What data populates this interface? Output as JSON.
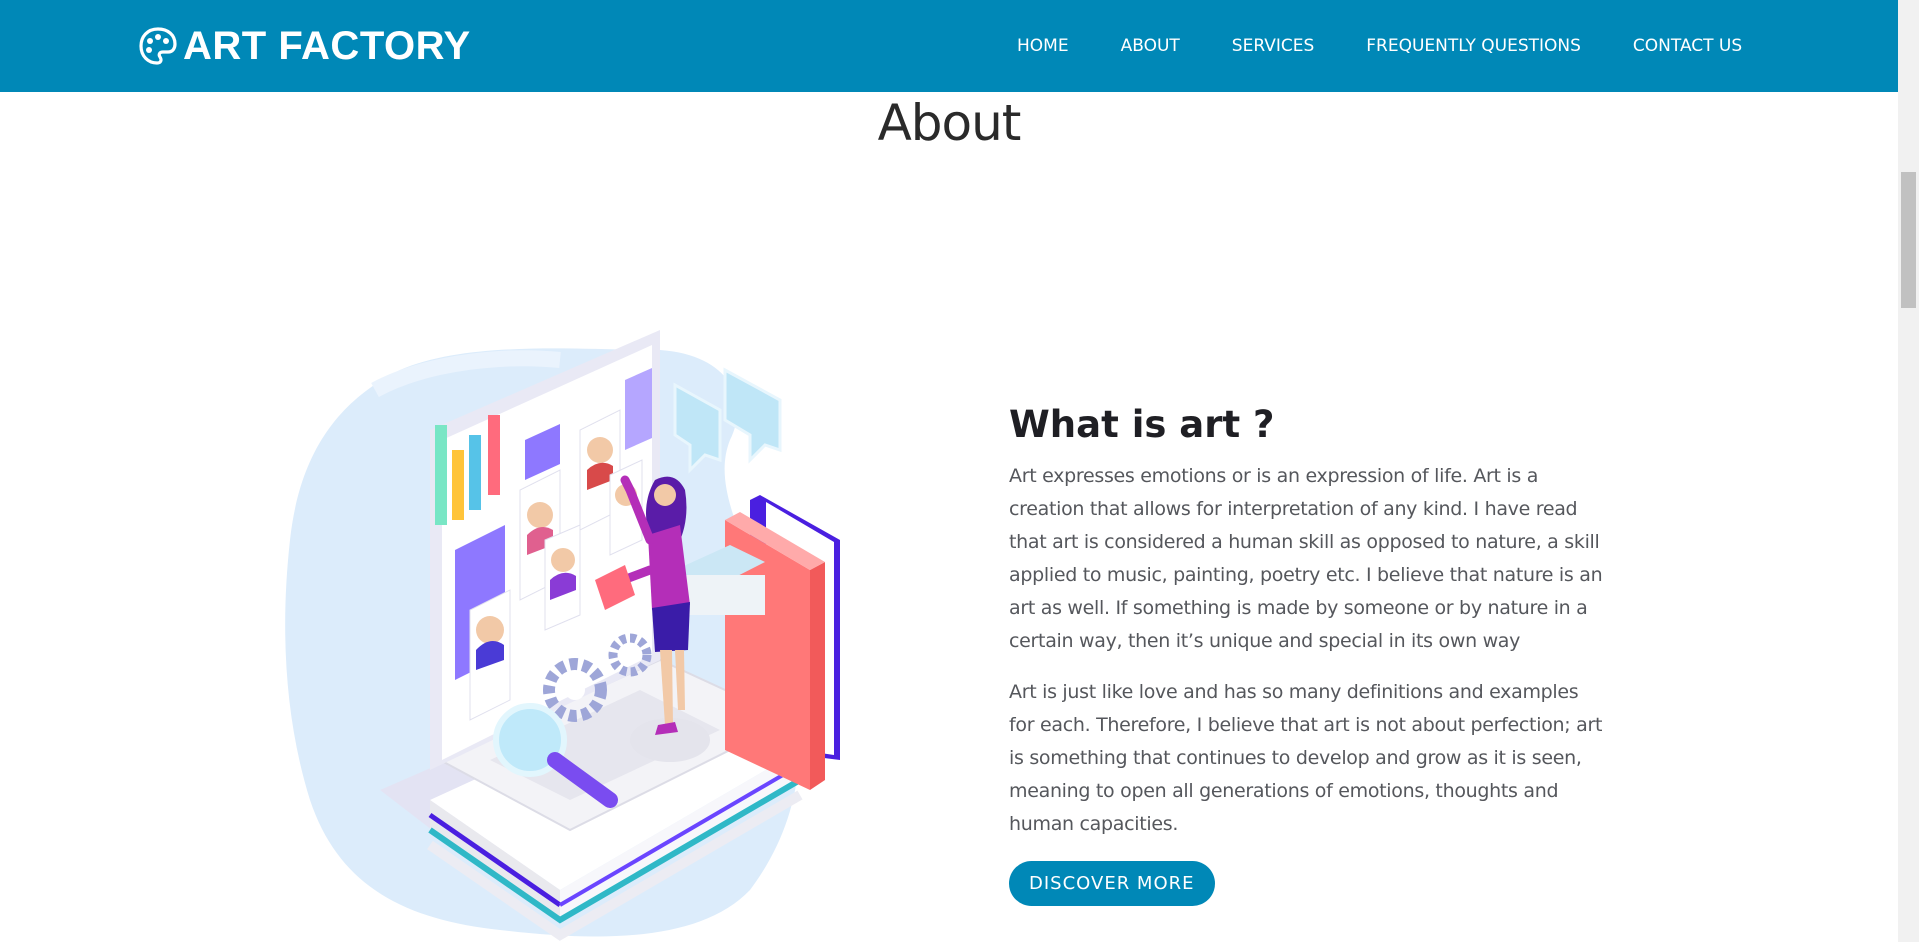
{
  "brand": {
    "name": "ART FACTORY",
    "icon": "palette-icon"
  },
  "nav": {
    "items": [
      "HOME",
      "ABOUT",
      "SERVICES",
      "FREQUENTLY QUESTIONS",
      "CONTACT US"
    ]
  },
  "section": {
    "title": "About"
  },
  "about": {
    "heading": "What is art ?",
    "paragraph1": "Art expresses emotions or is an expression of life. Art is a creation that allows for interpretation of any kind. I have read that art is considered a human skill as opposed to nature, a skill applied to music, painting, poetry etc. I believe that nature is an art as well. If something is made by someone or by nature in a certain way, then it’s unique and special in its own way",
    "paragraph2": "Art is just like love and has so many definitions and examples for each. Therefore, I believe that art is not about perfection; art is something that continues to develop and grow as it is seen, meaning to open all generations of emotions, thoughts and human capacities.",
    "button": "DISCOVER MORE"
  },
  "colors": {
    "primary": "#0088b7",
    "text_dark": "#1f1f24",
    "text_body": "#55575c"
  }
}
